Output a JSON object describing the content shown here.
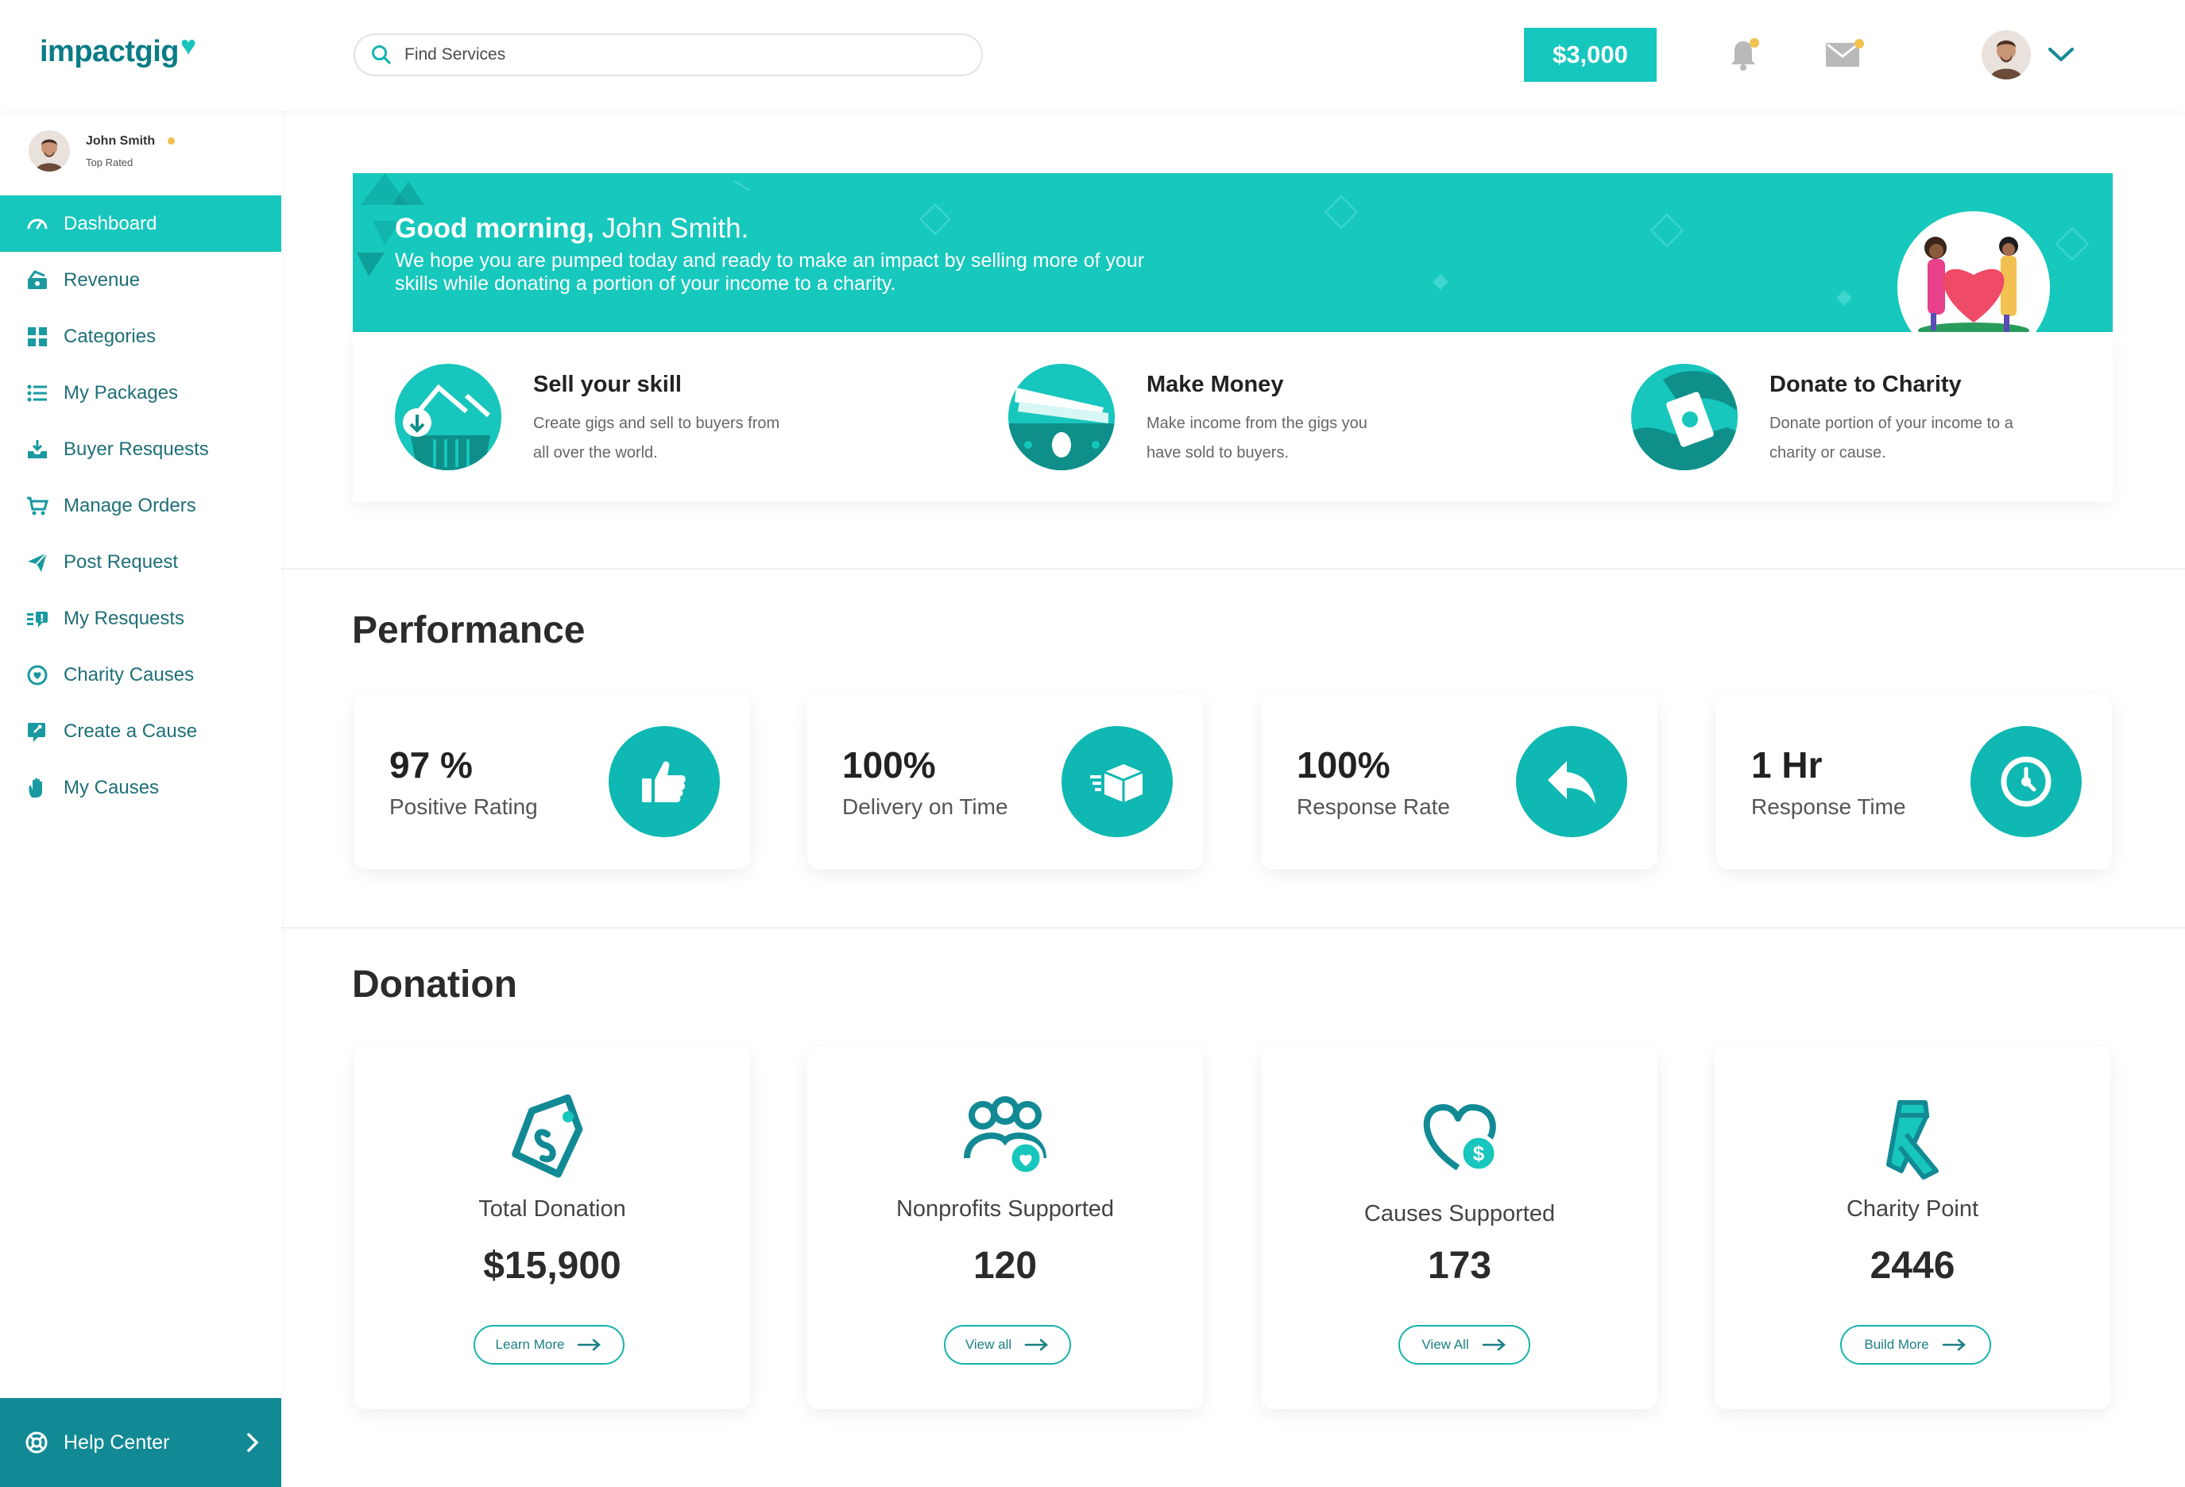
{
  "app": {
    "logo_text": "impactgig"
  },
  "search": {
    "placeholder": "Find Services"
  },
  "header": {
    "balance": "$3,000"
  },
  "user": {
    "name": "John Smith",
    "rank": "Top Rated"
  },
  "sidebar": {
    "items": [
      {
        "label": "Dashboard",
        "icon": "dashboard-icon",
        "active": true
      },
      {
        "label": "Revenue",
        "icon": "revenue-icon"
      },
      {
        "label": "Categories",
        "icon": "categories-icon"
      },
      {
        "label": "My Packages",
        "icon": "list-icon"
      },
      {
        "label": "Buyer Resquests",
        "icon": "inbox-download-icon"
      },
      {
        "label": "Manage Orders",
        "icon": "cart-icon"
      },
      {
        "label": "Post Request",
        "icon": "paper-plane-icon"
      },
      {
        "label": "My Resquests",
        "icon": "requests-icon"
      },
      {
        "label": "Charity Causes",
        "icon": "charity-icon"
      },
      {
        "label": "Create a Cause",
        "icon": "create-cause-icon"
      },
      {
        "label": "My Causes",
        "icon": "hand-icon"
      }
    ],
    "help_label": "Help Center"
  },
  "hero": {
    "greeting_bold": "Good morning,",
    "greeting_name": " John Smith.",
    "message": "We hope you are pumped today and ready to make an impact by selling more of your skills while donating a portion of your income to a charity."
  },
  "steps": [
    {
      "title": "Sell your skill",
      "desc": "Create gigs and sell to buyers from all over the world."
    },
    {
      "title": "Make Money",
      "desc": "Make income from the gigs you have sold to buyers."
    },
    {
      "title": "Donate to Charity",
      "desc": "Donate portion of your income to a charity or cause."
    }
  ],
  "performance": {
    "title": "Performance",
    "cards": [
      {
        "value": "97 %",
        "label": "Positive Rating",
        "icon": "thumbs-up-icon"
      },
      {
        "value": "100%",
        "label": "Delivery on Time",
        "icon": "delivery-box-icon"
      },
      {
        "value": "100%",
        "label": "Response Rate",
        "icon": "reply-icon"
      },
      {
        "value": "1 Hr",
        "label": "Response Time",
        "icon": "clock-icon"
      }
    ]
  },
  "donation": {
    "title": "Donation",
    "cards": [
      {
        "label": "Total Donation",
        "value": "$15,900",
        "button": "Learn More",
        "icon": "donation-tag-icon"
      },
      {
        "label": "Nonprofits Supported",
        "value": "120",
        "button": "View all",
        "icon": "group-heart-icon"
      },
      {
        "label": "Causes Supported",
        "value": "173",
        "button": "View All",
        "icon": "heart-dollar-icon"
      },
      {
        "label": "Charity Point",
        "value": "2446",
        "button": "Build More",
        "icon": "ribbon-icon"
      }
    ]
  },
  "colors": {
    "accent": "#17c6bc",
    "dark_accent": "#128a95",
    "text_teal": "#1f6f78",
    "badge": "#f2c14f"
  }
}
